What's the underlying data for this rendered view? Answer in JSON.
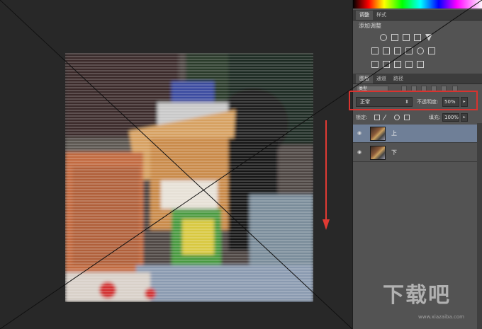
{
  "panel": {
    "adjustments_tabs": [
      "调整",
      "样式"
    ],
    "add_adjustment_label": "添加调整",
    "layers_tabs": [
      "图层",
      "通道",
      "路径"
    ],
    "filter_kind": "类型",
    "blend_mode": "正常",
    "opacity_label": "不透明度:",
    "opacity_value": "50%",
    "lock_label": "锁定:",
    "fill_label": "填充:",
    "fill_value": "100%",
    "layers": [
      {
        "name": "上",
        "selected": true
      },
      {
        "name": "下",
        "selected": false
      }
    ]
  },
  "watermark": {
    "text": "下载吧",
    "url": "www.xiazaiba.com"
  },
  "colors": {
    "highlight": "#d9332f",
    "arrow": "#e03a33",
    "panel_bg": "#535353",
    "canvas_bg": "#282828",
    "selected_layer": "#6f7f97"
  }
}
